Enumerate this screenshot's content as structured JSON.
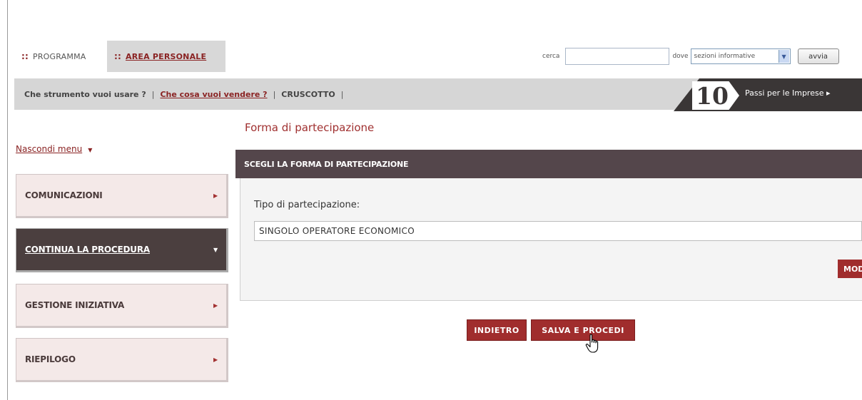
{
  "topnav": {
    "items": [
      {
        "bullets": "::",
        "label": "PROGRAMMA"
      },
      {
        "bullets": "::",
        "label": "AREA PERSONALE"
      }
    ]
  },
  "search": {
    "label": "cerca",
    "value": "",
    "where_label": "dove",
    "select_value": "sezioni informative",
    "button": "avvia"
  },
  "toolbar": {
    "items": [
      "Che strumento vuoi usare ?",
      "Che cosa vuoi vendere ?",
      "CRUSCOTTO"
    ],
    "separator": "|"
  },
  "banner": {
    "number": "10",
    "text": "Passi per le Imprese ▸"
  },
  "sidebar": {
    "hide_menu": "Nascondi menu",
    "hide_arrow": "▼",
    "items": [
      {
        "label": "COMUNICAZIONI",
        "arrow": "▶",
        "active": false
      },
      {
        "label": "CONTINUA LA PROCEDURA",
        "arrow": "▼",
        "active": true
      },
      {
        "label": "GESTIONE INIZIATIVA",
        "arrow": "▶",
        "active": false
      },
      {
        "label": "RIEPILOGO",
        "arrow": "▶",
        "active": false
      }
    ]
  },
  "main": {
    "title": "Forma di partecipazione",
    "panel_header": "SCEGLI LA FORMA DI PARTECIPAZIONE",
    "field_label": "Tipo di partecipazione:",
    "field_value": "SINGOLO OPERATORE ECONOMICO",
    "modify_button": "MODIFICA",
    "back_button": "INDIETRO",
    "save_button": "SALVA E PROCEDI"
  },
  "colors": {
    "accent": "#a02d2d",
    "dark": "#4b3f3f",
    "menu_bg": "#f4e9e8"
  }
}
